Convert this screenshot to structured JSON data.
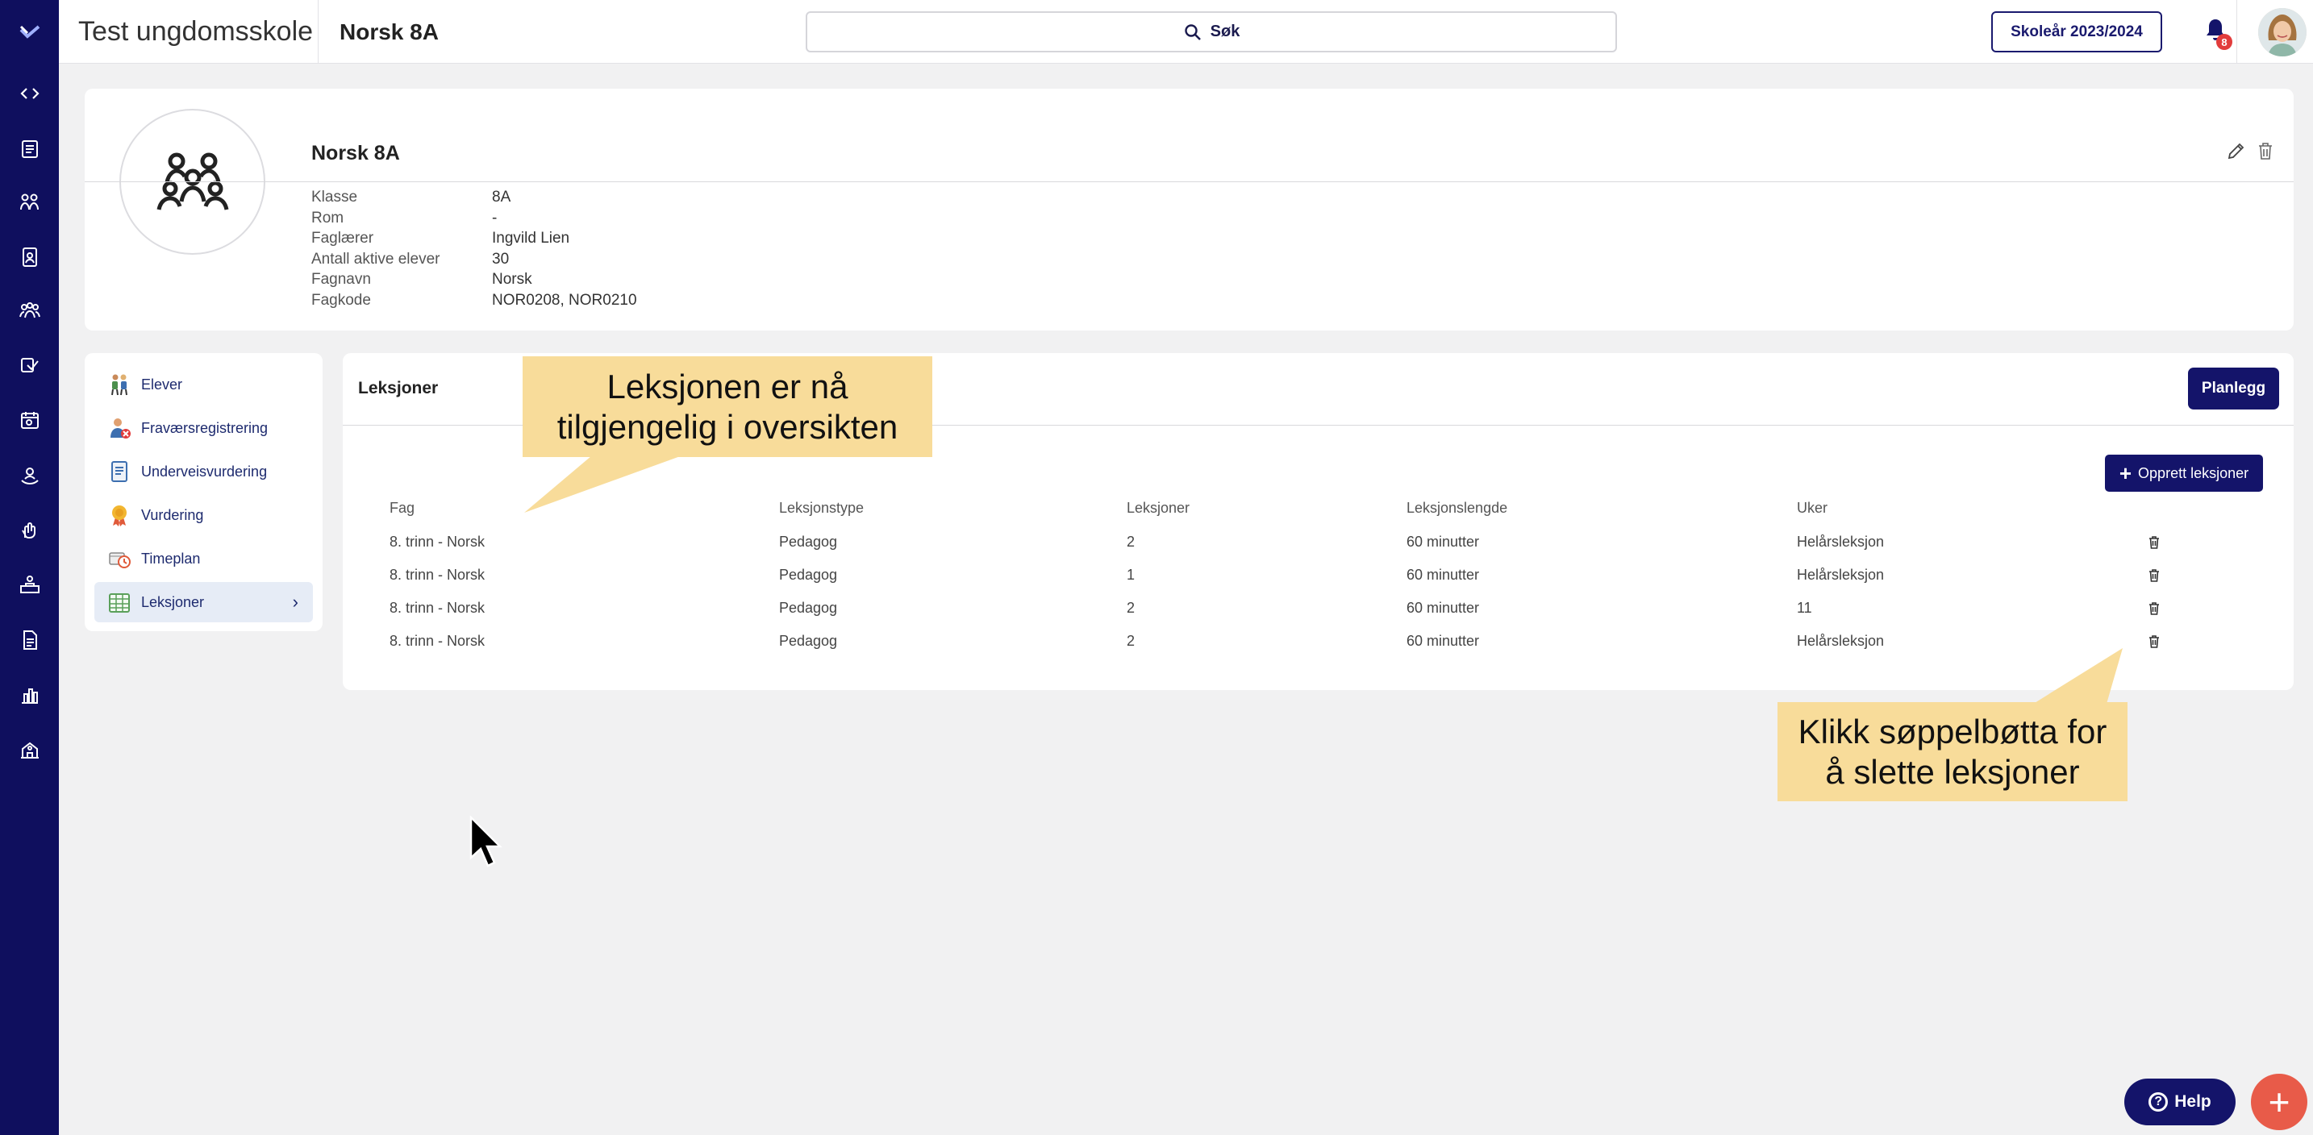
{
  "topbar": {
    "school_name": "Test ungdomsskole",
    "class_title": "Norsk 8A",
    "search_placeholder": "Søk",
    "school_year": "Skoleår 2023/2024",
    "notification_count": "8"
  },
  "profile": {
    "name": "Norsk 8A",
    "fields": [
      {
        "key": "Klasse",
        "value": "8A"
      },
      {
        "key": "Rom",
        "value": "-"
      },
      {
        "key": "Faglærer",
        "value": "Ingvild Lien"
      },
      {
        "key": "Antall aktive elever",
        "value": "30"
      },
      {
        "key": "Fagnavn",
        "value": "Norsk"
      },
      {
        "key": "Fagkode",
        "value": "NOR0208, NOR0210"
      }
    ]
  },
  "side_menu": {
    "items": [
      {
        "label": "Elever",
        "icon": "students-icon"
      },
      {
        "label": "Fraværsregistrering",
        "icon": "absence-icon"
      },
      {
        "label": "Underveisvurdering",
        "icon": "assessment-icon"
      },
      {
        "label": "Vurdering",
        "icon": "medal-icon"
      },
      {
        "label": "Timeplan",
        "icon": "timetable-icon"
      },
      {
        "label": "Leksjoner",
        "icon": "lessons-icon",
        "active": true
      }
    ]
  },
  "lessons": {
    "title": "Leksjoner",
    "plan_label": "Planlegg",
    "create_label": "Opprett leksjoner",
    "columns": [
      "Fag",
      "Leksjonstype",
      "Leksjoner",
      "Leksjonslengde",
      "Uker"
    ],
    "rows": [
      [
        "8. trinn - Norsk",
        "Pedagog",
        "2",
        "60 minutter",
        "Helårsleksjon"
      ],
      [
        "8. trinn - Norsk",
        "Pedagog",
        "1",
        "60 minutter",
        "Helårsleksjon"
      ],
      [
        "8. trinn - Norsk",
        "Pedagog",
        "2",
        "60 minutter",
        "11"
      ],
      [
        "8. trinn - Norsk",
        "Pedagog",
        "2",
        "60 minutter",
        "Helårsleksjon"
      ]
    ]
  },
  "callouts": {
    "top": [
      "Leksjonen er nå",
      "tilgjengelig i oversikten"
    ],
    "bottom": [
      "Klikk søppelbøtta for",
      "å slette leksjoner"
    ]
  },
  "help_label": "Help",
  "colors": {
    "nav_bg": "#0f0f5e",
    "primary_button": "#14146a",
    "callout": "#f8dc9a",
    "fab": "#e85b49",
    "badge": "#e23c3c"
  }
}
